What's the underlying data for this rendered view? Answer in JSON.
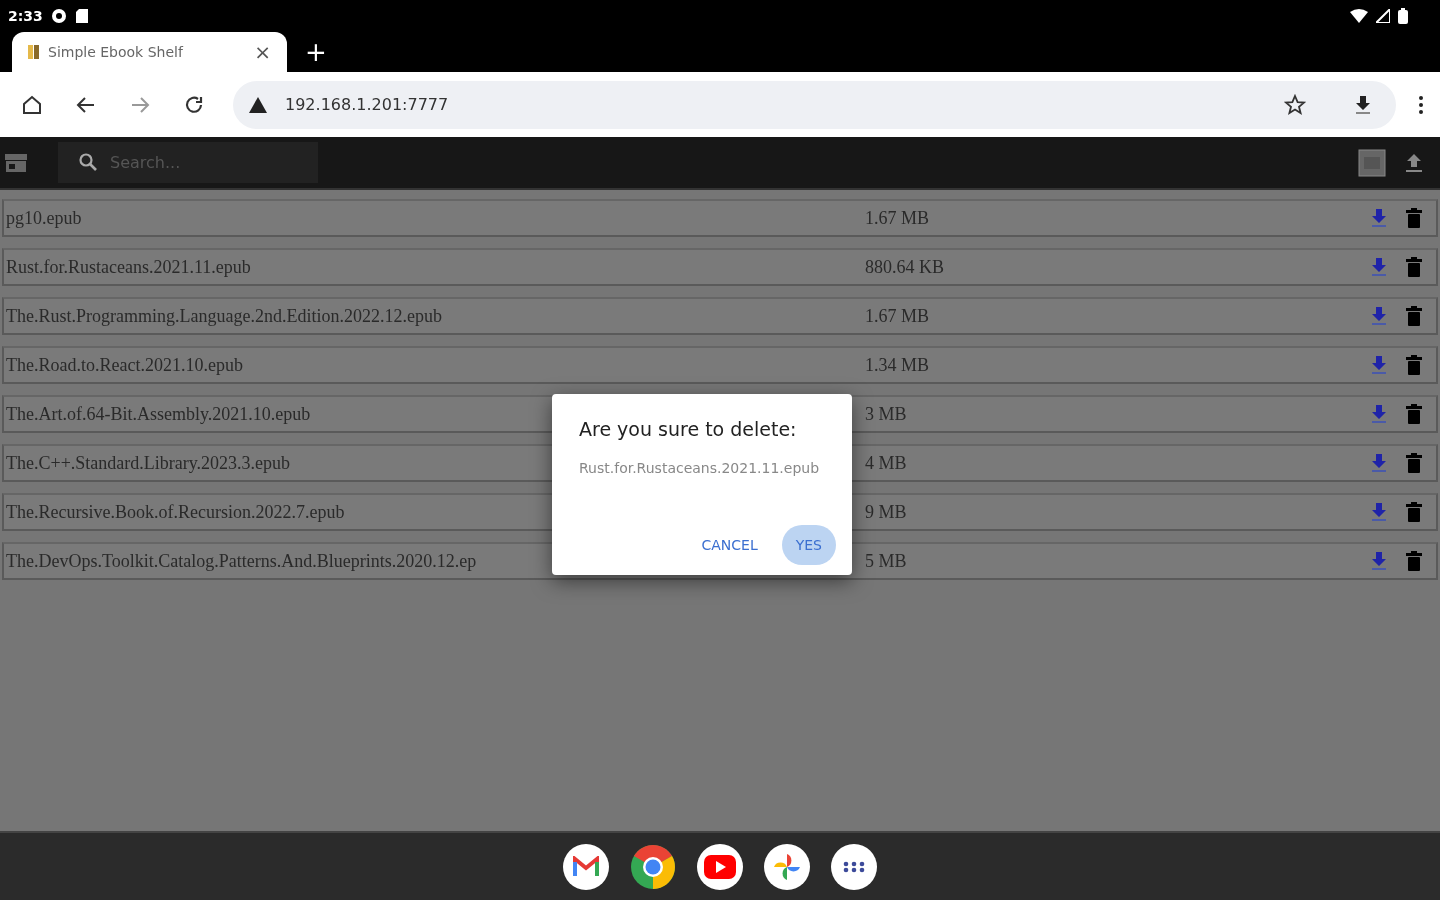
{
  "status_bar": {
    "time": "2:33"
  },
  "browser": {
    "tab": {
      "title": "Simple Ebook Shelf",
      "close": "×"
    },
    "new_tab": "+",
    "address": "192.168.1.201:7777"
  },
  "app": {
    "search": {
      "placeholder": "Search..."
    },
    "books": [
      {
        "name": "pg10.epub",
        "size": "1.67 MB"
      },
      {
        "name": "Rust.for.Rustaceans.2021.11.epub",
        "size": "880.64 KB"
      },
      {
        "name": "The.Rust.Programming.Language.2nd.Edition.2022.12.epub",
        "size": "1.67 MB"
      },
      {
        "name": "The.Road.to.React.2021.10.epub",
        "size": "1.34 MB"
      },
      {
        "name": "The.Art.of.64-Bit.Assembly.2021.10.epub",
        "size": "3 MB"
      },
      {
        "name": "The.C++.Standard.Library.2023.3.epub",
        "size": "4 MB"
      },
      {
        "name": "The.Recursive.Book.of.Recursion.2022.7.epub",
        "size": "9 MB"
      },
      {
        "name": "The.DevOps.Toolkit.Catalog.Patterns.And.Blueprints.2020.12.ep",
        "size": "5 MB"
      }
    ]
  },
  "dialog": {
    "title": "Are you sure to delete:",
    "message": "Rust.for.Rustaceans.2021.11.epub",
    "buttons": [
      {
        "label": "CANCEL",
        "selected": false
      },
      {
        "label": "YES",
        "selected": true
      }
    ]
  }
}
